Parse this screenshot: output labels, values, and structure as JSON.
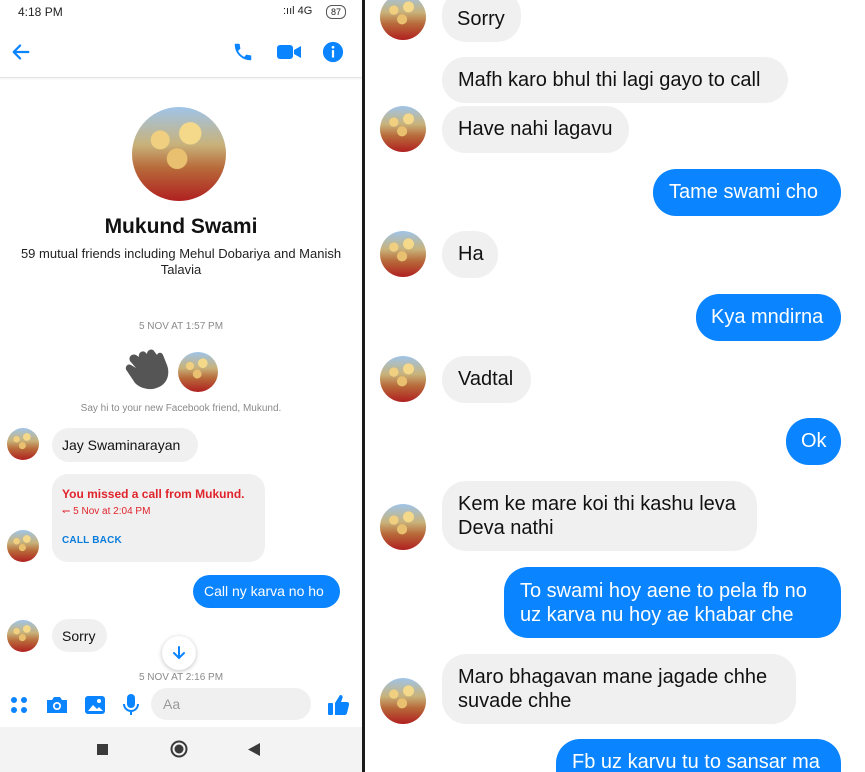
{
  "status": {
    "time": "4:18 PM",
    "network": ":ııl 4G",
    "battery": "87"
  },
  "header": {
    "back_icon": "arrow-left-icon",
    "call_icon": "phone-icon",
    "video_icon": "video-camera-icon",
    "info_icon": "info-icon"
  },
  "profile": {
    "name": "Mukund Swami",
    "mutual_friends": "59 mutual friends including Mehul Dobariya and Manish Talavia"
  },
  "left_chat": {
    "timestamp1": "5 NOV AT 1:57 PM",
    "say_hi": "Say hi to your new Facebook friend, Mukund.",
    "msg_jay": "Jay Swaminarayan",
    "missed_call": {
      "title": "You missed a call from Mukund.",
      "time": "↽ 5 Nov at 2:04 PM",
      "action": "CALL BACK"
    },
    "msg_call": "Call ny karva no ho",
    "msg_sorry": "Sorry",
    "timestamp2": "5 NOV AT 2:16 PM"
  },
  "composer": {
    "placeholder": "Aa"
  },
  "right_chat": {
    "messages": [
      {
        "dir": "in",
        "text": "Sorry"
      },
      {
        "dir": "in",
        "text": "Mafh karo bhul thi lagi gayo to call"
      },
      {
        "dir": "in",
        "text": "Have nahi lagavu"
      },
      {
        "dir": "out",
        "text": "Tame swami cho"
      },
      {
        "dir": "in",
        "text": "Ha"
      },
      {
        "dir": "out",
        "text": "Kya mndirna"
      },
      {
        "dir": "in",
        "text": "Vadtal"
      },
      {
        "dir": "out",
        "text": "Ok"
      },
      {
        "dir": "in",
        "text": "Kem ke mare koi thi kashu leva Deva nathi"
      },
      {
        "dir": "out",
        "text": "To swami hoy aene to pela fb no uz karva nu hoy ae khabar che"
      },
      {
        "dir": "in",
        "text": "Maro bhagavan mane jagade chhe suvade chhe"
      },
      {
        "dir": "out",
        "text": "Fb uz karvu tu to sansar ma"
      }
    ]
  },
  "colors": {
    "accent": "#0a84ff",
    "missed": "#e0242c",
    "bubble_in": "#f0f0f0"
  }
}
